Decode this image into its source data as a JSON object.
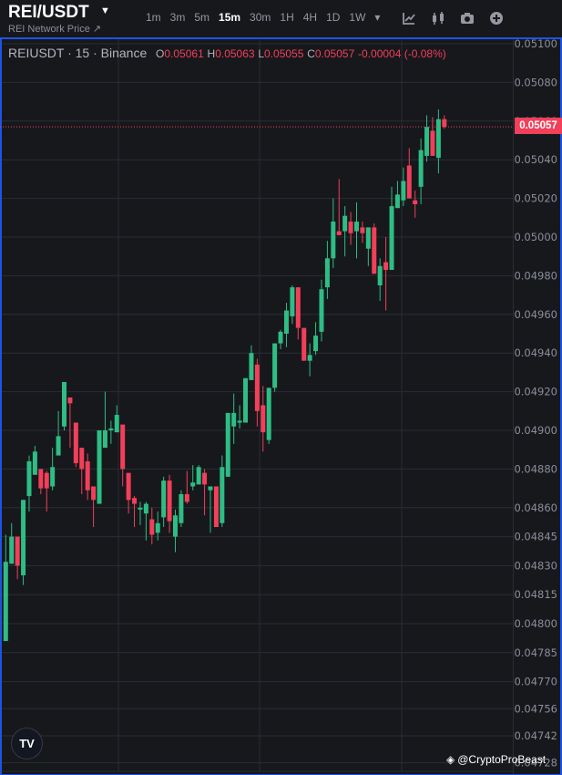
{
  "header": {
    "symbol": "REI/USDT",
    "subtitle": "REI Network Price ↗",
    "timeframes": [
      "1m",
      "3m",
      "5m",
      "15m",
      "30m",
      "1H",
      "4H",
      "1D",
      "1W"
    ],
    "active_timeframe": "15m",
    "more_caret": "▾",
    "tools": [
      "indicators-icon",
      "candle-type-icon",
      "camera-icon",
      "add-icon"
    ]
  },
  "legend": {
    "label": "REIUSDT · 15 · Binance",
    "o_key": "O",
    "o": "0.05061",
    "h_key": "H",
    "h": "0.05063",
    "l_key": "L",
    "l": "0.05055",
    "c_key": "C",
    "c": "0.05057",
    "change": "-0.00004 (-0.08%)"
  },
  "last_price_tag": "0.05057",
  "watermark": "@CryptoProBeast",
  "logo_text": "TV",
  "colors": {
    "up": "#2ebd85",
    "down": "#f23f5a",
    "bg": "#17181c",
    "grid": "#2a2d35",
    "accent": "#1e53e5"
  },
  "chart_data": {
    "type": "candlestick",
    "title": "REIUSDT · 15 · Binance",
    "xlabel": "",
    "ylabel": "",
    "ylim": [
      0.04722,
      0.05104
    ],
    "grid": true,
    "y_ticks": [
      "0.05100",
      "0.05080",
      "0.05060",
      "0.05040",
      "0.05020",
      "0.05000",
      "0.04980",
      "0.04960",
      "0.04940",
      "0.04920",
      "0.04900",
      "0.04880",
      "0.04860",
      "0.04845",
      "0.04830",
      "0.04815",
      "0.04800",
      "0.04785",
      "0.04770",
      "0.04756",
      "0.04742",
      "0.04728"
    ],
    "last_price": 0.05057,
    "candles_ohlc": [
      [
        0.04791,
        0.04846,
        0.04791,
        0.04832
      ],
      [
        0.04831,
        0.04852,
        0.04831,
        0.04845
      ],
      [
        0.04845,
        0.04845,
        0.04823,
        0.0483
      ],
      [
        0.04825,
        0.04864,
        0.0482,
        0.04864
      ],
      [
        0.04866,
        0.04887,
        0.04858,
        0.04884
      ],
      [
        0.04877,
        0.04892,
        0.04877,
        0.04889
      ],
      [
        0.0488,
        0.0488,
        0.04867,
        0.0487
      ],
      [
        0.04878,
        0.04879,
        0.04858,
        0.0487
      ],
      [
        0.04871,
        0.04891,
        0.04869,
        0.04881
      ],
      [
        0.04887,
        0.0491,
        0.04887,
        0.04897
      ],
      [
        0.04902,
        0.04925,
        0.049,
        0.04925
      ],
      [
        0.04917,
        0.04917,
        0.04891,
        0.04914
      ],
      [
        0.04904,
        0.04904,
        0.04881,
        0.04883
      ],
      [
        0.04891,
        0.04891,
        0.04867,
        0.0488
      ],
      [
        0.04884,
        0.04888,
        0.04864,
        0.04869
      ],
      [
        0.04871,
        0.04871,
        0.0485,
        0.04864
      ],
      [
        0.04862,
        0.049,
        0.04862,
        0.049
      ],
      [
        0.04891,
        0.0492,
        0.04891,
        0.049
      ],
      [
        0.049,
        0.04905,
        0.04893,
        0.04901
      ],
      [
        0.04899,
        0.04913,
        0.04899,
        0.04908
      ],
      [
        0.04903,
        0.04903,
        0.04871,
        0.0488
      ],
      [
        0.04878,
        0.04878,
        0.04857,
        0.04864
      ],
      [
        0.04865,
        0.04866,
        0.0485,
        0.04862
      ],
      [
        0.04859,
        0.04863,
        0.04851,
        0.0486
      ],
      [
        0.04857,
        0.04863,
        0.04843,
        0.04862
      ],
      [
        0.04854,
        0.0486,
        0.04841,
        0.04846
      ],
      [
        0.04847,
        0.04858,
        0.04843,
        0.04852
      ],
      [
        0.04855,
        0.04876,
        0.0485,
        0.04874
      ],
      [
        0.04874,
        0.04877,
        0.04847,
        0.04853
      ],
      [
        0.04845,
        0.04859,
        0.04837,
        0.04856
      ],
      [
        0.04852,
        0.04869,
        0.0485,
        0.04867
      ],
      [
        0.04867,
        0.04879,
        0.04862,
        0.04863
      ],
      [
        0.04871,
        0.04882,
        0.04869,
        0.04873
      ],
      [
        0.04872,
        0.04882,
        0.04872,
        0.04881
      ],
      [
        0.04878,
        0.0488,
        0.04856,
        0.04872
      ],
      [
        0.04869,
        0.04871,
        0.04847,
        0.04871
      ],
      [
        0.04871,
        0.04871,
        0.0485,
        0.0485
      ],
      [
        0.04852,
        0.04887,
        0.0485,
        0.04881
      ],
      [
        0.04876,
        0.04909,
        0.04876,
        0.04909
      ],
      [
        0.04902,
        0.04919,
        0.04893,
        0.04909
      ],
      [
        0.04904,
        0.04913,
        0.04901,
        0.04905
      ],
      [
        0.04904,
        0.04927,
        0.04904,
        0.04927
      ],
      [
        0.04926,
        0.04944,
        0.04926,
        0.0494
      ],
      [
        0.04934,
        0.04937,
        0.04902,
        0.0491
      ],
      [
        0.04913,
        0.04923,
        0.04889,
        0.04899
      ],
      [
        0.04895,
        0.04922,
        0.04893,
        0.04922
      ],
      [
        0.04922,
        0.04945,
        0.0492,
        0.04945
      ],
      [
        0.04945,
        0.04952,
        0.04942,
        0.04951
      ],
      [
        0.0495,
        0.04966,
        0.04943,
        0.04962
      ],
      [
        0.04959,
        0.04975,
        0.04955,
        0.04974
      ],
      [
        0.04974,
        0.04974,
        0.04947,
        0.04953
      ],
      [
        0.04953,
        0.04953,
        0.04936,
        0.04936
      ],
      [
        0.04936,
        0.04945,
        0.04928,
        0.04939
      ],
      [
        0.04941,
        0.04956,
        0.04939,
        0.04949
      ],
      [
        0.04951,
        0.04978,
        0.04946,
        0.04973
      ],
      [
        0.04974,
        0.04998,
        0.04968,
        0.04989
      ],
      [
        0.04989,
        0.0502,
        0.04984,
        0.05008
      ],
      [
        0.05003,
        0.0503,
        0.05001,
        0.05001
      ],
      [
        0.05003,
        0.05016,
        0.0499,
        0.05011
      ],
      [
        0.05008,
        0.05013,
        0.04996,
        0.05002
      ],
      [
        0.05003,
        0.05018,
        0.04989,
        0.05008
      ],
      [
        0.05005,
        0.05008,
        0.04997,
        0.05002
      ],
      [
        0.04994,
        0.05005,
        0.04985,
        0.05005
      ],
      [
        0.05005,
        0.05007,
        0.04981,
        0.04981
      ],
      [
        0.04975,
        0.04989,
        0.04967,
        0.04985
      ],
      [
        0.04987,
        0.05,
        0.04962,
        0.04983
      ],
      [
        0.04983,
        0.05026,
        0.04983,
        0.05016
      ],
      [
        0.05015,
        0.05029,
        0.05015,
        0.05022
      ],
      [
        0.05019,
        0.05036,
        0.05016,
        0.05029
      ],
      [
        0.05037,
        0.05046,
        0.0502,
        0.0502
      ],
      [
        0.05019,
        0.05024,
        0.0501,
        0.05017
      ],
      [
        0.05026,
        0.05051,
        0.05017,
        0.05045
      ],
      [
        0.05042,
        0.05063,
        0.05039,
        0.05057
      ],
      [
        0.05055,
        0.05062,
        0.05042,
        0.05042
      ],
      [
        0.05041,
        0.05066,
        0.05033,
        0.05061
      ],
      [
        0.05061,
        0.05063,
        0.05056,
        0.05057
      ]
    ]
  }
}
